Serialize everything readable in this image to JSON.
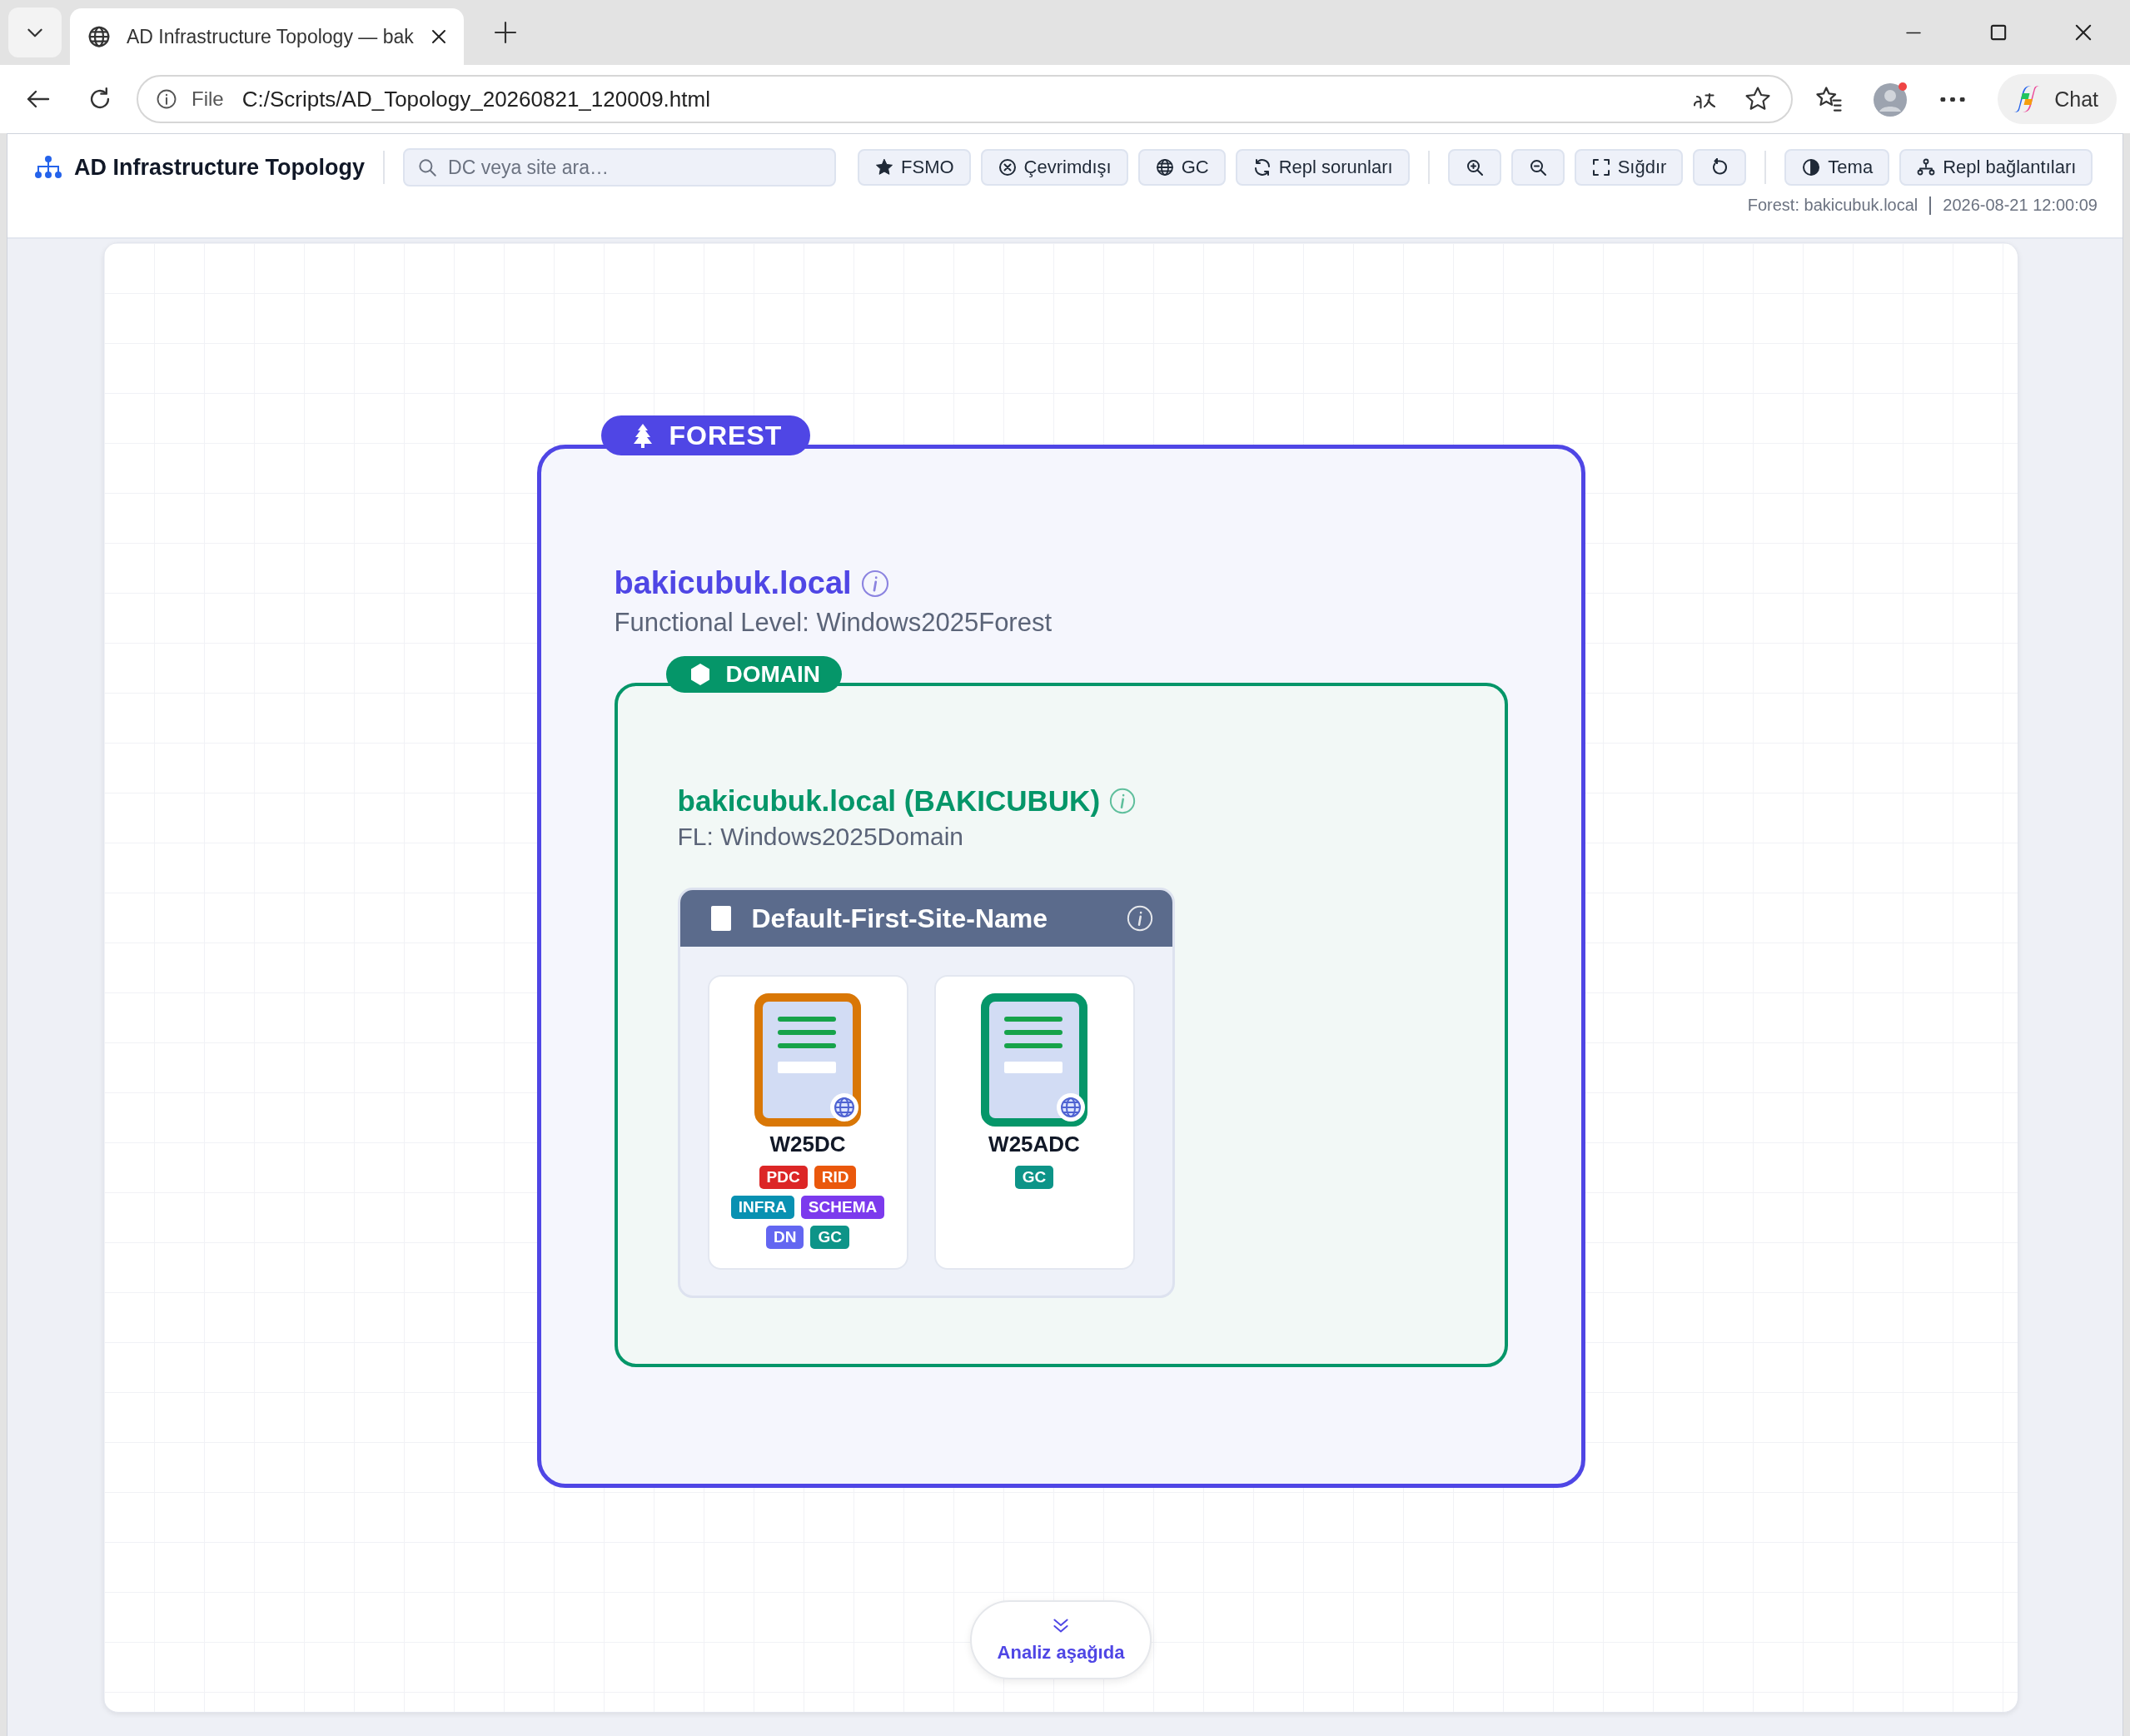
{
  "browser": {
    "tab_title": "AD Infrastructure Topology — bak",
    "url_scheme": "File",
    "url": "C:/Scripts/AD_Topology_20260821_120009.html",
    "chat_label": "Chat"
  },
  "app": {
    "title": "AD Infrastructure Topology",
    "search": {
      "placeholder": "DC veya site ara…"
    },
    "toolbar_groups": [
      [
        {
          "kind": "star",
          "label": "FSMO"
        },
        {
          "kind": "offline",
          "label": "Çevrimdışı"
        },
        {
          "kind": "globe",
          "label": "GC"
        },
        {
          "kind": "refresh",
          "label": "Repl sorunları"
        }
      ],
      [
        {
          "kind": "zoom-in"
        },
        {
          "kind": "zoom-out"
        },
        {
          "kind": "fit",
          "label": "Sığdır"
        },
        {
          "kind": "reset"
        }
      ],
      [
        {
          "kind": "theme",
          "label": "Tema"
        },
        {
          "kind": "network",
          "label": "Repl bağlantıları"
        }
      ]
    ],
    "meta": {
      "forest": "Forest: bakicubuk.local",
      "timestamp": "2026-08-21 12:00:09"
    }
  },
  "forest": {
    "badge": "FOREST",
    "name": "bakicubuk.local",
    "functional_level": "Functional Level: Windows2025Forest",
    "domain": {
      "badge": "DOMAIN",
      "name": "bakicubuk.local (BAKICUBUK)",
      "functional_level": "FL: Windows2025Domain",
      "site": {
        "name": "Default-First-Site-Name",
        "dcs": [
          {
            "name": "W25DC",
            "color": "#d97706",
            "badges": [
              {
                "label": "PDC",
                "color": "#dc2626"
              },
              {
                "label": "RID",
                "color": "#ea580c"
              },
              {
                "label": "INFRA",
                "color": "#0891b2"
              },
              {
                "label": "SCHEMA",
                "color": "#7c3aed"
              },
              {
                "label": "DN",
                "color": "#6366f1"
              },
              {
                "label": "GC",
                "color": "#0d9488"
              }
            ]
          },
          {
            "name": "W25ADC",
            "color": "#059669",
            "badges": [
              {
                "label": "GC",
                "color": "#0d9488"
              }
            ]
          }
        ]
      }
    }
  },
  "analysis_button": {
    "label": "Analiz aşağıda"
  }
}
